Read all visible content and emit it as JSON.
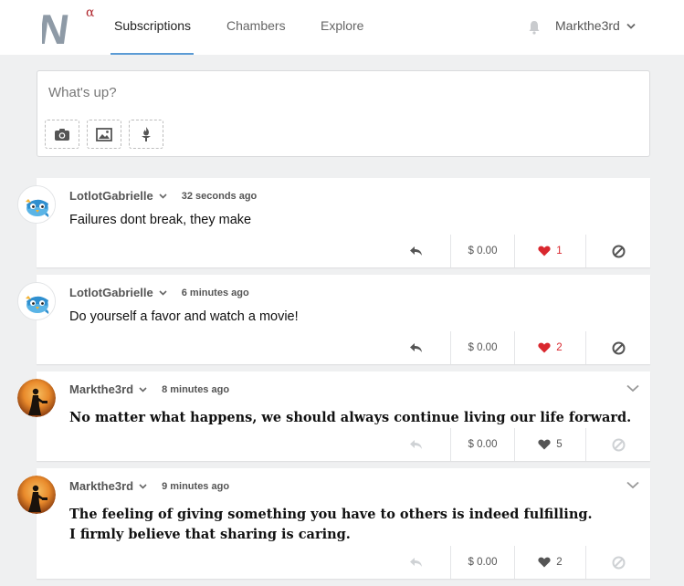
{
  "header": {
    "logo": {
      "letter": "N",
      "superscript": "α",
      "letter_color": "#8e9aa6",
      "superscript_color": "#b0272e"
    },
    "tabs": [
      {
        "label": "Subscriptions",
        "active": true
      },
      {
        "label": "Chambers",
        "active": false
      },
      {
        "label": "Explore",
        "active": false
      }
    ],
    "accent_color": "#5b9bd5",
    "notification_icon": "bell-icon",
    "username": "Markthe3rd"
  },
  "composer": {
    "placeholder": "What's up?",
    "buttons": [
      {
        "icon": "camera-icon"
      },
      {
        "icon": "image-icon"
      },
      {
        "icon": "torch-icon"
      }
    ]
  },
  "posts": [
    {
      "user": "LotlotGabrielle",
      "time": "32 seconds ago",
      "avatar": "bird",
      "lines": [
        "Failures dont break, they make"
      ],
      "tip": "$ 0.00",
      "likes": "1",
      "liked": true,
      "own": false
    },
    {
      "user": "LotlotGabrielle",
      "time": "6 minutes ago",
      "avatar": "bird",
      "lines": [
        "Do yourself a favor and watch a movie!"
      ],
      "tip": "$ 0.00",
      "likes": "2",
      "liked": true,
      "own": false
    },
    {
      "user": "Markthe3rd",
      "time": "8 minutes ago",
      "avatar": "silhouette",
      "lines": [
        "No matter what happens, we should always continue living our life forward."
      ],
      "tip": "$ 0.00",
      "likes": "5",
      "liked": false,
      "own": true
    },
    {
      "user": "Markthe3rd",
      "time": "9 minutes ago",
      "avatar": "silhouette",
      "lines": [
        "The feeling of giving something you have to others is indeed fulfilling.",
        "I firmly believe that sharing is caring."
      ],
      "tip": "$ 0.00",
      "likes": "2",
      "liked": false,
      "own": true
    }
  ],
  "colors": {
    "like_active": "#d9272e",
    "like_inactive": "#555555",
    "icon": "#555555",
    "icon_disabled": "#cfd2d5"
  }
}
